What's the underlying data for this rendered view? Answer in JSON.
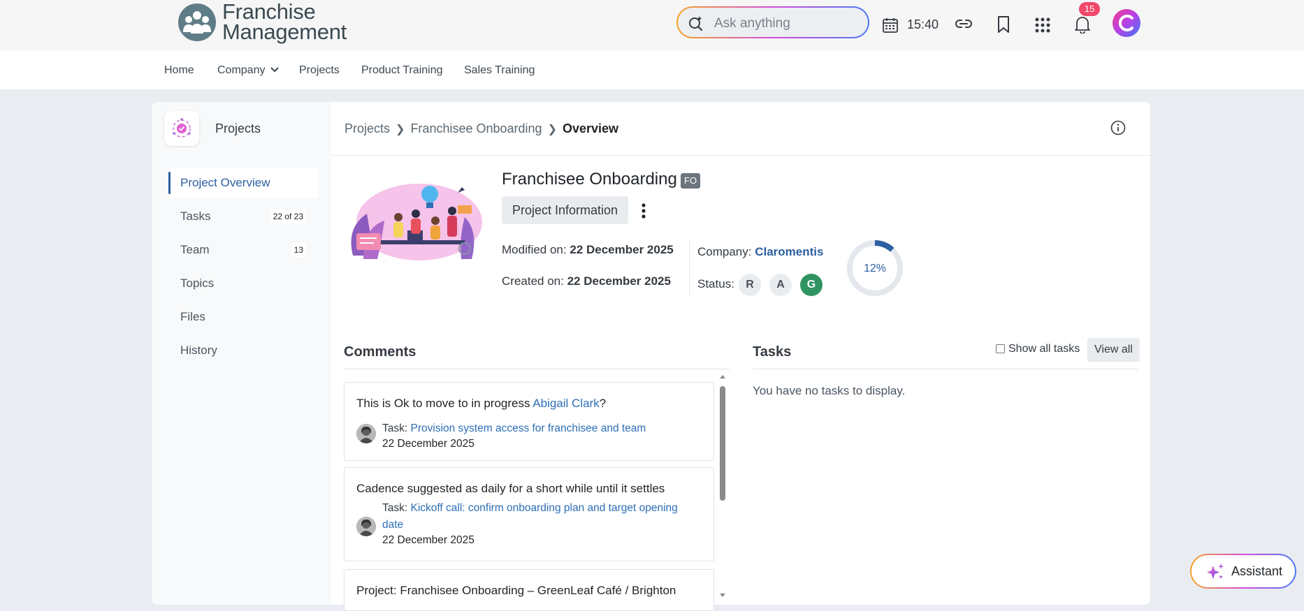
{
  "brand": {
    "line1": "Franchise",
    "line2": "Management"
  },
  "topbar": {
    "search_placeholder": "Ask anything",
    "time": "15:40",
    "notifications_count": "15"
  },
  "nav": {
    "items": [
      {
        "label": "Home"
      },
      {
        "label": "Company"
      },
      {
        "label": "Projects"
      },
      {
        "label": "Product Training"
      },
      {
        "label": "Sales Training"
      }
    ]
  },
  "sidebar": {
    "title": "Projects",
    "items": [
      {
        "label": "Project Overview",
        "count": ""
      },
      {
        "label": "Tasks",
        "count": "22 of 23"
      },
      {
        "label": "Team",
        "count": "13"
      },
      {
        "label": "Topics",
        "count": ""
      },
      {
        "label": "Files",
        "count": ""
      },
      {
        "label": "History",
        "count": ""
      }
    ]
  },
  "breadcrumb": [
    "Projects",
    "Franchisee Onboarding",
    "Overview"
  ],
  "project": {
    "title": "Franchisee Onboarding",
    "code": "FO",
    "info_button": "Project Information",
    "modified_label": "Modified on:",
    "modified_value": "22 December 2025",
    "created_label": "Created on:",
    "created_value": "22 December 2025",
    "company_label": "Company:",
    "company_value": "Claromentis",
    "status_label": "Status:",
    "status_options": [
      "R",
      "A",
      "G"
    ],
    "status_selected": "G",
    "progress_text": "12%",
    "progress_value": 12
  },
  "comments": {
    "title": "Comments",
    "items": [
      {
        "text": "This is Ok to move to in progress ",
        "mention": "Abigail Clark",
        "suffix": "?",
        "task_label": "Task:",
        "task_link": "Provision system access for franchisee and team",
        "date": "22 December 2025"
      },
      {
        "text": "Cadence suggested as daily for a short while until it settles",
        "task_label": "Task:",
        "task_link": "Kickoff call: confirm onboarding plan and target opening date",
        "date": "22 December 2025"
      },
      {
        "text": "Project: Franchisee Onboarding – GreenLeaf Café / Brighton"
      }
    ]
  },
  "tasks": {
    "title": "Tasks",
    "show_all_label": "Show all tasks",
    "view_all_label": "View all",
    "empty_text": "You have no tasks to display."
  },
  "assistant": {
    "label": "Assistant"
  },
  "colors": {
    "accent": "#2c5fa0",
    "status_green": "#2f9460",
    "badge": "#f2486a"
  }
}
